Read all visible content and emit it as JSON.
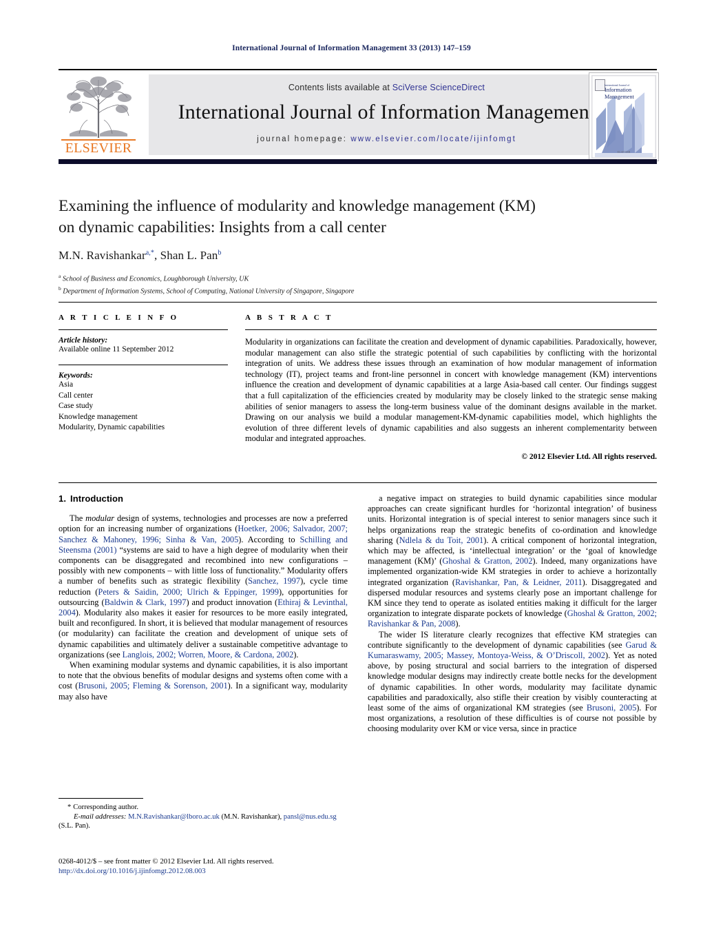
{
  "running_head": "International Journal of Information Management 33 (2013) 147–159",
  "masthead": {
    "contents_prefix": "Contents lists available at ",
    "sciencedirect": "SciVerse ScienceDirect",
    "journal_name": "International Journal of Information Management",
    "homepage_prefix": "journal homepage: ",
    "homepage_url": "www.elsevier.com/locate/ijinfomgt",
    "publisher_wordmark": "ELSEVIER",
    "publisher_color": "#e87722",
    "link_color": "#2e3192",
    "band_color": "#e7e7e9",
    "cover": {
      "line1": "International Journal of",
      "line2": "Information",
      "line3": "Management",
      "footer": "ELSEVIER"
    }
  },
  "article": {
    "title_line1": "Examining the influence of modularity and knowledge management (KM)",
    "title_line2": "on dynamic capabilities: Insights from a call center",
    "authors": [
      {
        "name": "M.N. Ravishankar",
        "marks": "a,*"
      },
      {
        "name": "Shan L. Pan",
        "marks": "b"
      }
    ],
    "author_separator": ", ",
    "affiliations": [
      {
        "mark": "a",
        "text": "School of Business and Economics, Loughborough University, UK"
      },
      {
        "mark": "b",
        "text": "Department of Information Systems, School of Computing, National University of Singapore, Singapore"
      }
    ]
  },
  "article_info": {
    "heading": "A R T I C L E  I N F O",
    "history_label": "Article history:",
    "history_value": "Available online 11 September 2012",
    "keywords_label": "Keywords:",
    "keywords": [
      "Asia",
      "Call center",
      "Case study",
      "Knowledge management",
      "Modularity, Dynamic capabilities"
    ]
  },
  "abstract": {
    "heading": "A B S T R A C T",
    "body": "Modularity in organizations can facilitate the creation and development of dynamic capabilities. Paradoxically, however, modular management can also stifle the strategic potential of such capabilities by conflicting with the horizontal integration of units. We address these issues through an examination of how modular management of information technology (IT), project teams and front-line personnel in concert with knowledge management (KM) interventions influence the creation and development of dynamic capabilities at a large Asia-based call center. Our findings suggest that a full capitalization of the efficiencies created by modularity may be closely linked to the strategic sense making abilities of senior managers to assess the long-term business value of the dominant designs available in the market. Drawing on our analysis we build a modular management-KM-dynamic capabilities model, which highlights the evolution of three different levels of dynamic capabilities and also suggests an inherent complementarity between modular and integrated approaches.",
    "copyright": "© 2012 Elsevier Ltd. All rights reserved."
  },
  "introduction": {
    "number": "1.",
    "heading": "Introduction",
    "left_paragraphs": [
      {
        "segments": [
          {
            "t": "The "
          },
          {
            "t": "modular",
            "style": "italic"
          },
          {
            "t": " design of systems, technologies and processes are now a preferred option for an increasing number of organizations ("
          },
          {
            "t": "Hoetker, 2006; Salvador, 2007; Sanchez & Mahoney, 1996; Sinha & Van, 2005",
            "style": "cite"
          },
          {
            "t": "). According to "
          },
          {
            "t": "Schilling and Steensma (2001)",
            "style": "cite"
          },
          {
            "t": " “systems are said to have a high degree of modularity when their components can be disaggregated and recombined into new configurations – possibly with new components – with little loss of functionality.” Modularity offers a number of benefits such as strategic flexibility ("
          },
          {
            "t": "Sanchez, 1997",
            "style": "cite"
          },
          {
            "t": "), cycle time reduction ("
          },
          {
            "t": "Peters & Saidin, 2000; Ulrich & Eppinger, 1999",
            "style": "cite"
          },
          {
            "t": "), opportunities for outsourcing ("
          },
          {
            "t": "Baldwin & Clark, 1997",
            "style": "cite"
          },
          {
            "t": ") and product innovation ("
          },
          {
            "t": "Ethiraj & Levinthal, 2004",
            "style": "cite"
          },
          {
            "t": "). Modularity also makes it easier for resources to be more easily integrated, built and reconfigured. In short, it is believed that modular management of resources (or modularity) can facilitate the creation and development of unique sets of dynamic capabilities and ultimately deliver a sustainable competitive advantage to organizations (see "
          },
          {
            "t": "Langlois, 2002; Worren, Moore, & Cardona, 2002",
            "style": "cite"
          },
          {
            "t": ")."
          }
        ]
      },
      {
        "segments": [
          {
            "t": "When examining modular systems and dynamic capabilities, it is also important to note that the obvious benefits of modular designs and systems often come with a cost ("
          },
          {
            "t": "Brusoni, 2005; Fleming & Sorenson, 2001",
            "style": "cite"
          },
          {
            "t": "). In a significant way, modularity may also have"
          }
        ]
      }
    ],
    "right_paragraphs": [
      {
        "segments": [
          {
            "t": "a negative impact on strategies to build dynamic capabilities since modular approaches can create significant hurdles for ‘horizontal integration’ of business units. Horizontal integration is of special interest to senior managers since such it helps organizations reap the strategic benefits of co-ordination and knowledge sharing ("
          },
          {
            "t": "Ndlela & du Toit, 2001",
            "style": "cite"
          },
          {
            "t": "). A critical component of horizontal integration, which may be affected, is ‘intellectual integration’ or the ‘goal of knowledge management (KM)’ ("
          },
          {
            "t": "Ghoshal & Gratton, 2002",
            "style": "cite"
          },
          {
            "t": "). Indeed, many organizations have implemented organization-wide KM strategies in order to achieve a horizontally integrated organization ("
          },
          {
            "t": "Ravishankar, Pan, & Leidner, 2011",
            "style": "cite"
          },
          {
            "t": "). Disaggregated and dispersed modular resources and systems clearly pose an important challenge for KM since they tend to operate as isolated entities making it difficult for the larger organization to integrate disparate pockets of knowledge ("
          },
          {
            "t": "Ghoshal & Gratton, 2002; Ravishankar & Pan, 2008",
            "style": "cite"
          },
          {
            "t": ")."
          }
        ]
      },
      {
        "segments": [
          {
            "t": "The wider IS literature clearly recognizes that effective KM strategies can contribute significantly to the development of dynamic capabilities (see "
          },
          {
            "t": "Garud & Kumaraswamy, 2005; Massey, Montoya-Weiss, & O’Driscoll, 2002",
            "style": "cite"
          },
          {
            "t": "). Yet as noted above, by posing structural and social barriers to the integration of dispersed knowledge modular designs may indirectly create bottle necks for the development of dynamic capabilities. In other words, modularity may facilitate dynamic capabilities and paradoxically, also stifle their creation by visibly counteracting at least some of the aims of organizational KM strategies (see "
          },
          {
            "t": "Brusoni, 2005",
            "style": "cite"
          },
          {
            "t": "). For most organizations, a resolution of these difficulties is of course not possible by choosing modularity over KM or vice versa, since in practice"
          }
        ]
      }
    ]
  },
  "footnote": {
    "star": "*",
    "corresponding": "Corresponding author.",
    "email_label": "E-mail addresses:",
    "email1": "M.N.Ravishankar@lboro.ac.uk",
    "email1_owner": "(M.N. Ravishankar),",
    "email2": "pansl@nus.edu.sg",
    "email2_owner": "(S.L. Pan)."
  },
  "imprint": {
    "front_matter": "0268-4012/$ – see front matter © 2012 Elsevier Ltd. All rights reserved.",
    "doi": "http://dx.doi.org/10.1016/j.ijinfomgt.2012.08.003"
  }
}
